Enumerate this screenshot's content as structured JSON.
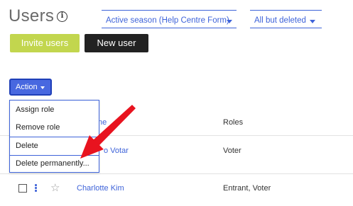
{
  "page": {
    "title": "Users",
    "info_symbol": "i"
  },
  "filters": {
    "season": "Active season (Help Centre Form)",
    "deleted": "All but deleted"
  },
  "buttons": {
    "invite": "Invite users",
    "new_user": "New user"
  },
  "action": {
    "label": "Action",
    "menu": [
      "Assign role",
      "Remove role",
      "Delete",
      "Delete permanently..."
    ]
  },
  "table": {
    "headers": {
      "name": "ne",
      "roles": "Roles"
    },
    "rows": [
      {
        "name": "o Votar",
        "roles": "Voter"
      },
      {
        "name": "Charlotte Kim",
        "roles": "Entrant, Voter"
      }
    ]
  },
  "colors": {
    "accent": "#3e63d9",
    "invite": "#c2d64e",
    "annotation_arrow": "#e8131f"
  }
}
